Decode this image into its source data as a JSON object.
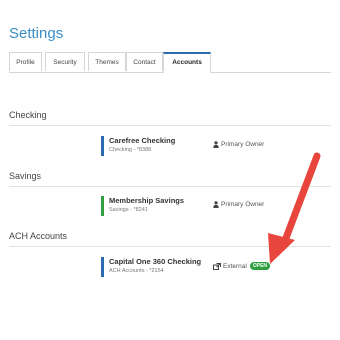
{
  "page": {
    "title": "Settings"
  },
  "tabs": [
    {
      "label": "Profile",
      "active": false
    },
    {
      "label": "Security",
      "active": false
    },
    {
      "label": "Themes",
      "active": false
    },
    {
      "label": "Contact",
      "active": false
    },
    {
      "label": "Accounts",
      "active": true
    }
  ],
  "sections": [
    {
      "label": "Checking",
      "account": {
        "name": "Carefree Checking",
        "sub": "Checking - *8388",
        "color": "#2b6cb0",
        "ownership": "Primary Owner"
      }
    },
    {
      "label": "Savings",
      "account": {
        "name": "Membership Savings",
        "sub": "Savings - *8241",
        "color": "#2e9e3e",
        "ownership": "Primary Owner"
      }
    },
    {
      "label": "ACH Accounts",
      "account": {
        "name": "Capital One 360 Checking",
        "sub": "ACH Accounts - *2154",
        "color": "#2b6cb0",
        "ownership": "External",
        "status": "OPEN"
      }
    }
  ],
  "colors": {
    "accent": "#3a8fc4",
    "open_badge": "#2e9e3e",
    "annotation_arrow": "#e8453c"
  }
}
